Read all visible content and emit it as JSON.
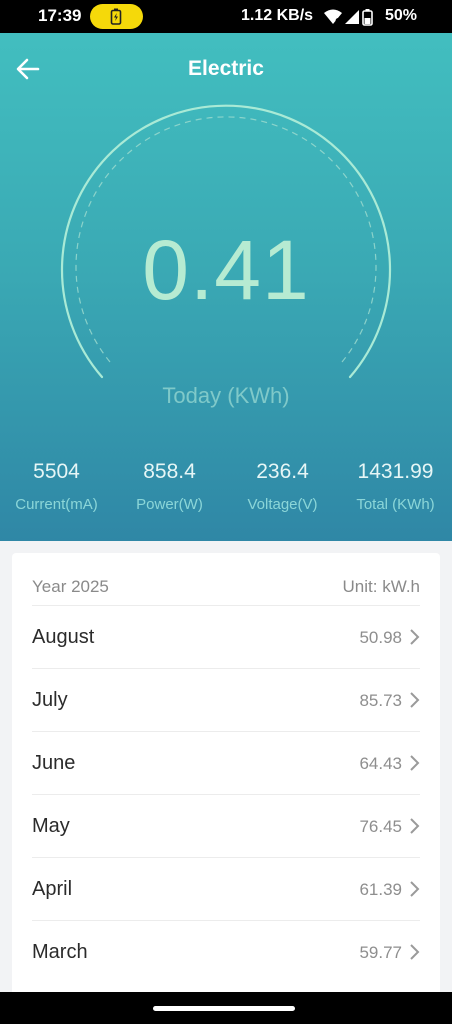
{
  "status_bar": {
    "time": "17:39",
    "net_speed": "1.12 KB/s",
    "battery_pct": "50%",
    "battery_pill_color": "#f5d90a"
  },
  "header": {
    "back_icon": "arrow-left-icon",
    "title": "Electric"
  },
  "gauge": {
    "value": "0.41",
    "caption": "Today (KWh)"
  },
  "stats": [
    {
      "value": "5504",
      "label": "Current(mA)"
    },
    {
      "value": "858.4",
      "label": "Power(W)"
    },
    {
      "value": "236.4",
      "label": "Voltage(V)"
    },
    {
      "value": "1431.99",
      "label": "Total (KWh)"
    }
  ],
  "history": {
    "year_label": "Year 2025",
    "unit_label": "Unit: kW.h",
    "rows": [
      {
        "month": "August",
        "value": "50.98"
      },
      {
        "month": "July",
        "value": "85.73"
      },
      {
        "month": "June",
        "value": "64.43"
      },
      {
        "month": "May",
        "value": "76.45"
      },
      {
        "month": "April",
        "value": "61.39"
      },
      {
        "month": "March",
        "value": "59.77"
      }
    ]
  },
  "colors": {
    "hero_top": "#43c1c1",
    "hero_bottom": "#2f87a6",
    "gauge_value": "#b6ebd2"
  }
}
